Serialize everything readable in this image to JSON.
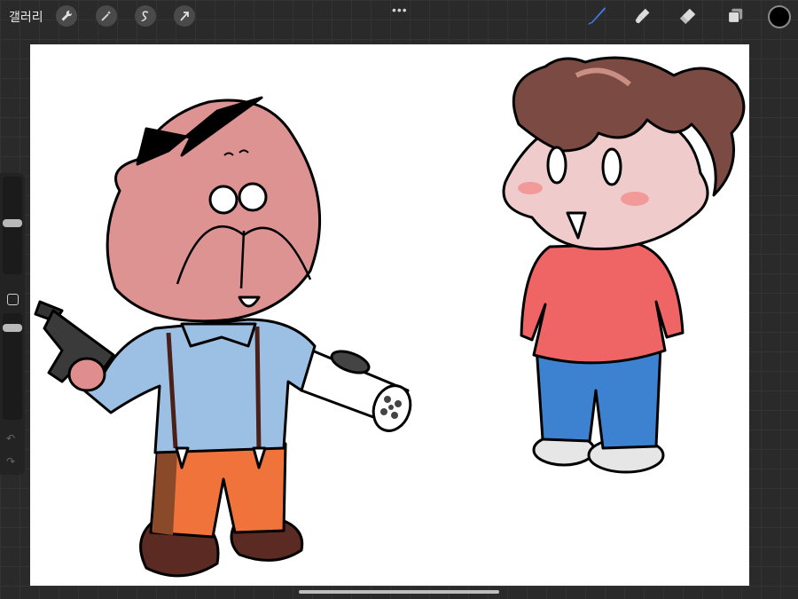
{
  "topbar": {
    "gallery_label": "갤러리",
    "more_label": "•••",
    "left_tools": [
      "wrench-icon",
      "magic-wand-icon",
      "selection-icon",
      "transform-arrow-icon"
    ],
    "right_tools": [
      "brush-icon",
      "smudge-icon",
      "eraser-icon",
      "layers-icon"
    ],
    "active_tool": "brush",
    "accent_color": "#3d7de6",
    "current_color": "#000000"
  },
  "sidebar": {
    "brush_size_icon": "slider-thumb",
    "opacity_icon": "slider-thumb",
    "modify_icon": "square-icon",
    "undo_icon": "undo-arrow-icon",
    "redo_icon": "redo-arrow-icon"
  },
  "canvas": {
    "background": "#ffffff",
    "contents": [
      "old-man-character",
      "girl-character"
    ]
  }
}
